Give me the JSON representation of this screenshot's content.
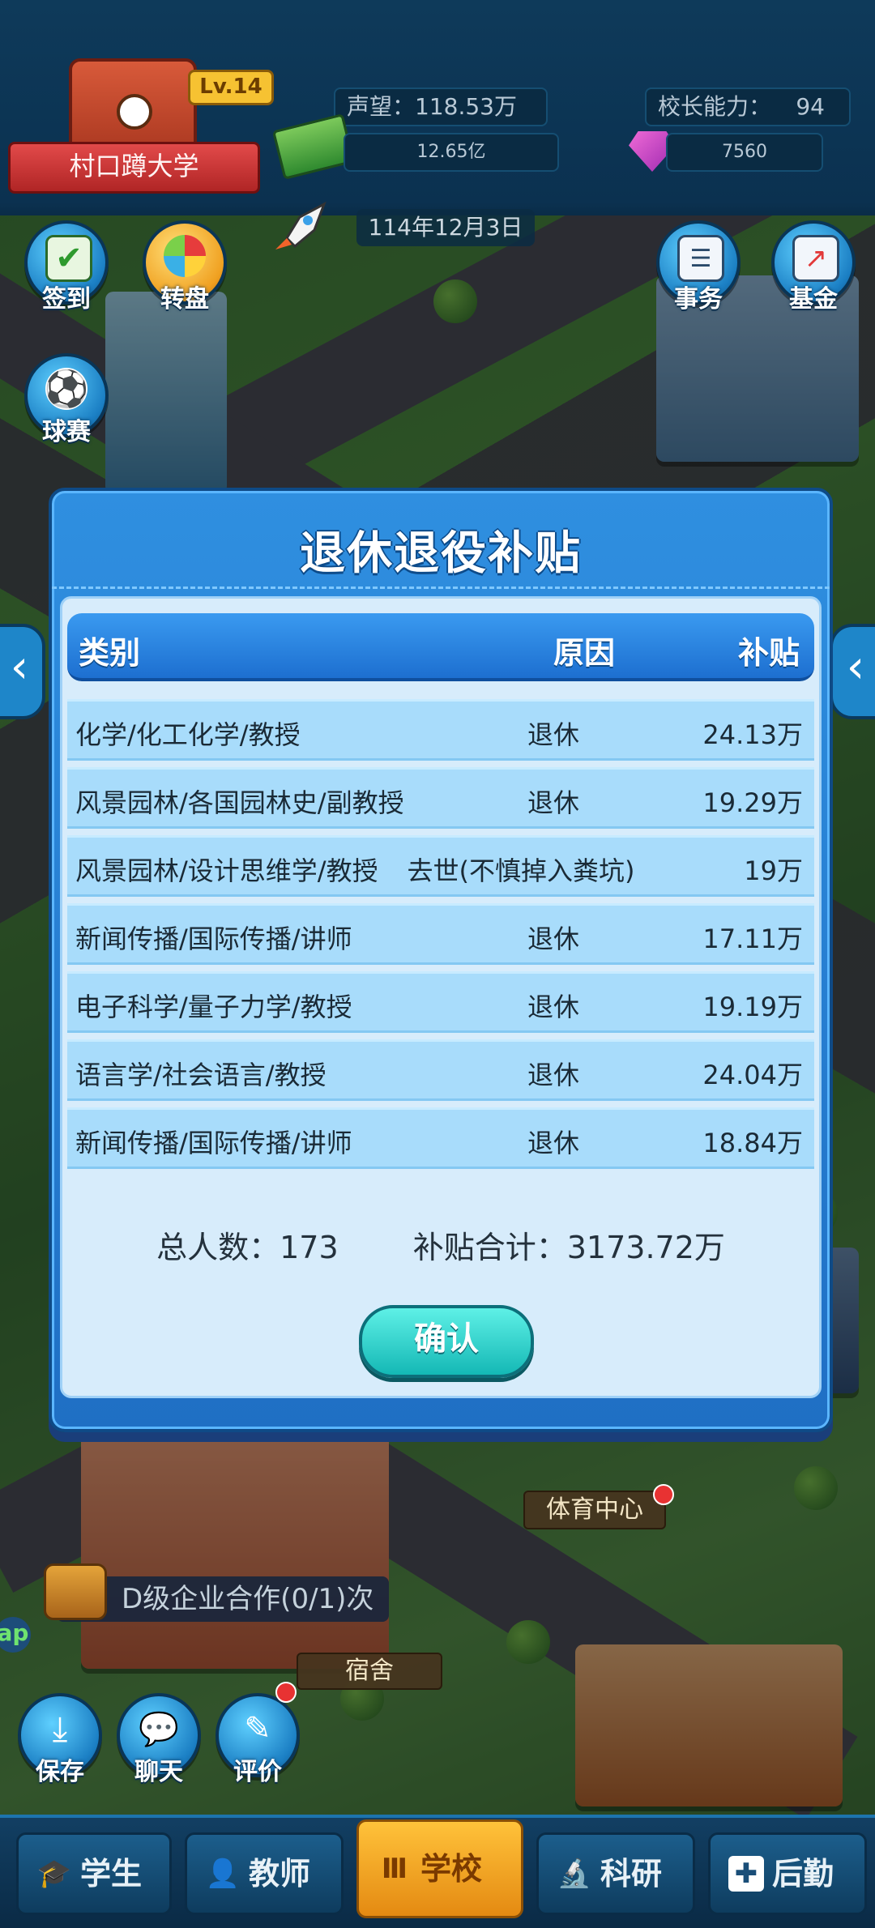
{
  "hud": {
    "school_name": "村口蹲大学",
    "level": "Lv.14",
    "reputation": "声望：118.53万",
    "principal_ability_label": "校长能力：",
    "principal_ability_value": "94",
    "money": "12.65亿",
    "gems": "7560",
    "date": "114年12月3日"
  },
  "left_buttons": [
    {
      "label": "签到",
      "icon": "checkin-icon"
    },
    {
      "label": "转盘",
      "icon": "wheel-icon"
    },
    {
      "label": "球赛",
      "icon": "soccer-ball-icon"
    }
  ],
  "right_buttons": [
    {
      "label": "事务",
      "icon": "clipboard-icon"
    },
    {
      "label": "基金",
      "icon": "chart-up-icon"
    }
  ],
  "modal": {
    "title": "退休退役补贴",
    "headers": {
      "category": "类别",
      "reason": "原因",
      "subsidy": "补贴"
    },
    "rows": [
      {
        "category": "化学/化工化学/教授",
        "reason": "退休",
        "subsidy": "24.13万"
      },
      {
        "category": "风景园林/各国园林史/副教授",
        "reason": "退休",
        "subsidy": "19.29万"
      },
      {
        "category": "风景园林/设计思维学/教授",
        "reason": "去世(不慎掉入粪坑)",
        "subsidy": "19万"
      },
      {
        "category": "新闻传播/国际传播/讲师",
        "reason": "退休",
        "subsidy": "17.11万"
      },
      {
        "category": "电子科学/量子力学/教授",
        "reason": "退休",
        "subsidy": "19.19万"
      },
      {
        "category": "语言学/社会语言/教授",
        "reason": "退休",
        "subsidy": "24.04万"
      },
      {
        "category": "新闻传播/国际传播/讲师",
        "reason": "退休",
        "subsidy": "18.84万"
      }
    ],
    "summary": {
      "total_people_label": "总人数：",
      "total_people": "173",
      "total_subsidy_label": "补贴合计：",
      "total_subsidy": "3173.72万"
    },
    "confirm_label": "确认"
  },
  "world_labels": {
    "sports_center": "体育中心",
    "dormitory": "宿舍",
    "cooperation": "D级企业合作(0/1)次",
    "side_text": "ap"
  },
  "bottom_left_buttons": [
    {
      "label": "保存",
      "icon": "save-icon"
    },
    {
      "label": "聊天",
      "icon": "chat-icon"
    },
    {
      "label": "评价",
      "icon": "review-icon"
    }
  ],
  "bottom_nav": [
    {
      "label": "学生",
      "icon": "graduation-cap-icon"
    },
    {
      "label": "教师",
      "icon": "teacher-icon"
    },
    {
      "label": "学校",
      "icon": "school-building-icon",
      "active": true
    },
    {
      "label": "科研",
      "icon": "microscope-icon"
    },
    {
      "label": "后勤",
      "icon": "first-aid-icon"
    }
  ],
  "colors": {
    "modal_blue": "#1f6fc4",
    "row_blue": "#a8dcfb",
    "confirm_teal": "#14b8b5",
    "active_tab_orange": "#e48a12"
  }
}
